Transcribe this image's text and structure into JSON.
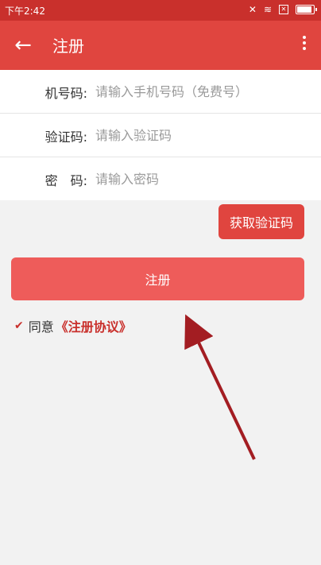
{
  "status_bar": {
    "time": "下午2:42"
  },
  "app_bar": {
    "back_icon": "back-arrow-icon",
    "title": "注册",
    "more_icon": "more-vert-icon"
  },
  "form": {
    "fields": [
      {
        "label": "机号码:",
        "placeholder": "请输入手机号码（免费号）"
      },
      {
        "label": "验证码:",
        "placeholder": "请输入验证码"
      },
      {
        "label": "密　码:",
        "placeholder": "请输入密码"
      }
    ]
  },
  "actions": {
    "get_code_label": "获取验证码",
    "register_label": "注册"
  },
  "agreement": {
    "checked": true,
    "prefix": "同意",
    "link_text": "《注册协议》"
  },
  "colors": {
    "primary": "#e0453f",
    "status_bar": "#c9302c",
    "register_button": "#ee5c5a",
    "background": "#f2f2f2"
  }
}
